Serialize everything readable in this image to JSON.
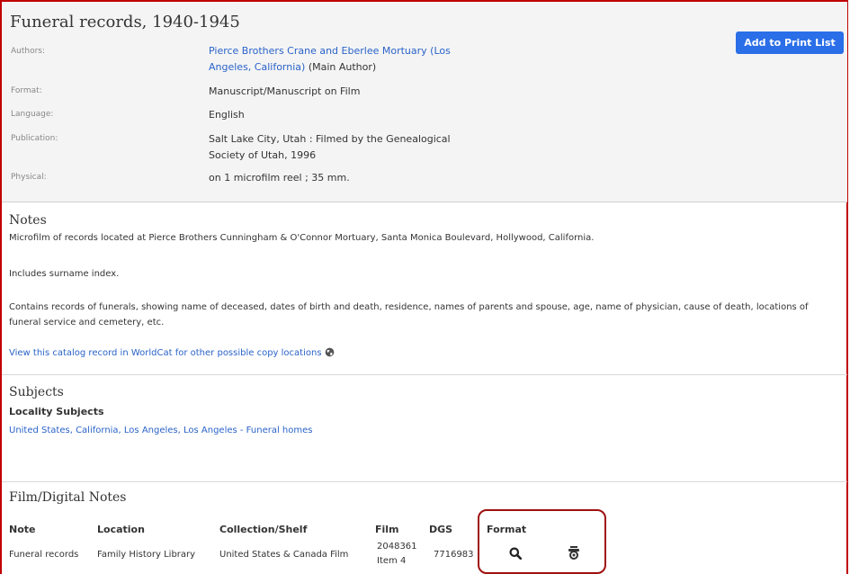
{
  "record": {
    "title": "Funeral records, 1940-1945",
    "print_button": "Add to Print List",
    "authors_label": "Authors:",
    "authors_link": "Pierce Brothers Crane and Eberlee Mortuary (Los Angeles, California)",
    "authors_role": "(Main Author)",
    "format_label": "Format:",
    "format_value": "Manuscript/Manuscript on Film",
    "language_label": "Language:",
    "language_value": "English",
    "publication_label": "Publication:",
    "publication_value": "Salt Lake City, Utah : Filmed by the Genealogical Society of Utah, 1996",
    "physical_label": "Physical:",
    "physical_value": "on 1 microfilm reel ; 35 mm."
  },
  "notes": {
    "heading": "Notes",
    "p1": "Microfilm of records located at Pierce Brothers Cunningham & O'Connor Mortuary, Santa Monica Boulevard, Hollywood, California.",
    "p2": "Includes surname index.",
    "p3": "Contains records of funerals, showing name of deceased, dates of birth and death, residence, names of parents and spouse, age, name of physician, cause of death, locations of funeral service and cemetery, etc.",
    "worldcat_link": "View this catalog record in WorldCat for other possible copy locations"
  },
  "subjects": {
    "heading": "Subjects",
    "subheading": "Locality Subjects",
    "link": "United States, California, Los Angeles, Los Angeles - Funeral homes"
  },
  "film": {
    "heading": "Film/Digital Notes",
    "columns": [
      "Note",
      "Location",
      "Collection/Shelf",
      "Film",
      "DGS",
      "Format"
    ],
    "row": {
      "note": "Funeral records",
      "location": "Family History Library",
      "collection": "United States & Canada Film",
      "film_line1": "2048361",
      "film_line2": "Item 4",
      "dgs": "7716983"
    }
  },
  "icons": {
    "globe": "globe-icon",
    "search": "search-icon",
    "camera": "camera-icon"
  }
}
